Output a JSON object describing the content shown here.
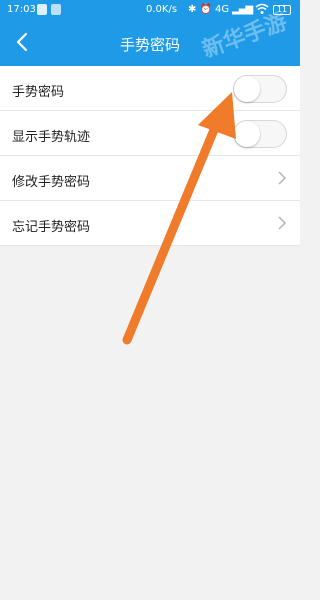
{
  "status_bar": {
    "time": "17:03",
    "network_speed": "0.0K/s",
    "network_type": "4G",
    "battery_level": "11"
  },
  "header": {
    "title": "手势密码"
  },
  "settings": [
    {
      "label": "手势密码",
      "control": "toggle",
      "checked": false
    },
    {
      "label": "显示手势轨迹",
      "control": "toggle",
      "checked": false
    },
    {
      "label": "修改手势密码",
      "control": "chevron"
    },
    {
      "label": "忘记手势密码",
      "control": "chevron"
    }
  ],
  "watermark": "新华手游",
  "colors": {
    "header_bg": "#1f9ae6",
    "arrow": "#f07b2b",
    "page_bg": "#f2f2f2"
  }
}
